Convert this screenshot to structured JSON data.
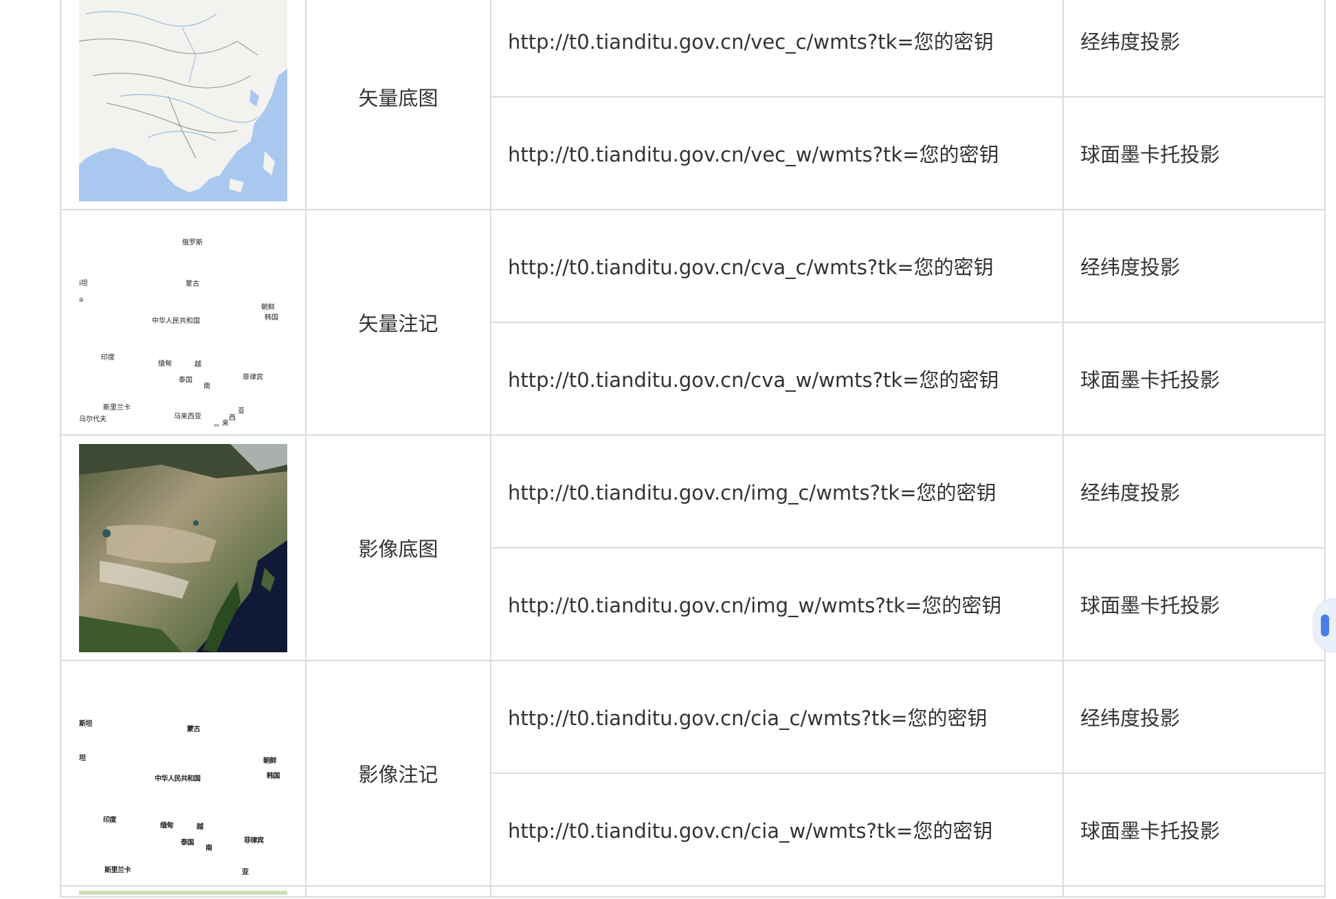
{
  "rows": [
    {
      "name": "矢量底图",
      "thumb_type": "vector-map",
      "urls": [
        {
          "url": "http://t0.tianditu.gov.cn/vec_c/wmts?tk=您的密钥",
          "projection": "经纬度投影"
        },
        {
          "url": "http://t0.tianditu.gov.cn/vec_w/wmts?tk=您的密钥",
          "projection": "球面墨卡托投影"
        }
      ]
    },
    {
      "name": "矢量注记",
      "thumb_type": "vector-labels",
      "labels": [
        "俄罗斯",
        "i坦",
        "蒙古",
        "ǝ",
        "朝鲜",
        "中华人民共和国",
        "韩国",
        "印度",
        "缅甸",
        "越",
        "泰国",
        "菲律宾",
        "南",
        "斯里兰卡",
        "亚",
        "马尔代夫",
        "马来西亚",
        "西",
        "来",
        "马"
      ],
      "urls": [
        {
          "url": "http://t0.tianditu.gov.cn/cva_c/wmts?tk=您的密钥",
          "projection": "经纬度投影"
        },
        {
          "url": "http://t0.tianditu.gov.cn/cva_w/wmts?tk=您的密钥",
          "projection": "球面墨卡托投影"
        }
      ]
    },
    {
      "name": "影像底图",
      "thumb_type": "satellite-image",
      "urls": [
        {
          "url": "http://t0.tianditu.gov.cn/img_c/wmts?tk=您的密钥",
          "projection": "经纬度投影"
        },
        {
          "url": "http://t0.tianditu.gov.cn/img_w/wmts?tk=您的密钥",
          "projection": "球面墨卡托投影"
        }
      ]
    },
    {
      "name": "影像注记",
      "thumb_type": "image-labels",
      "labels": [
        "斯坦",
        "蒙古",
        "坦",
        "朝鲜",
        "韩国",
        "中华人民共和国",
        "印度",
        "缅甸",
        "越",
        "泰国",
        "菲律宾",
        "南",
        "斯里兰卡",
        "亚"
      ],
      "urls": [
        {
          "url": "http://t0.tianditu.gov.cn/cia_c/wmts?tk=您的密钥",
          "projection": "经纬度投影"
        },
        {
          "url": "http://t0.tianditu.gov.cn/cia_w/wmts?tk=您的密钥",
          "projection": "球面墨卡托投影"
        }
      ]
    }
  ],
  "colors": {
    "border": "#dcdcdc",
    "text": "#333333",
    "ocean": "#a8c8f0",
    "land": "#f2f2ee",
    "side_widget": "#4a7cf0"
  }
}
